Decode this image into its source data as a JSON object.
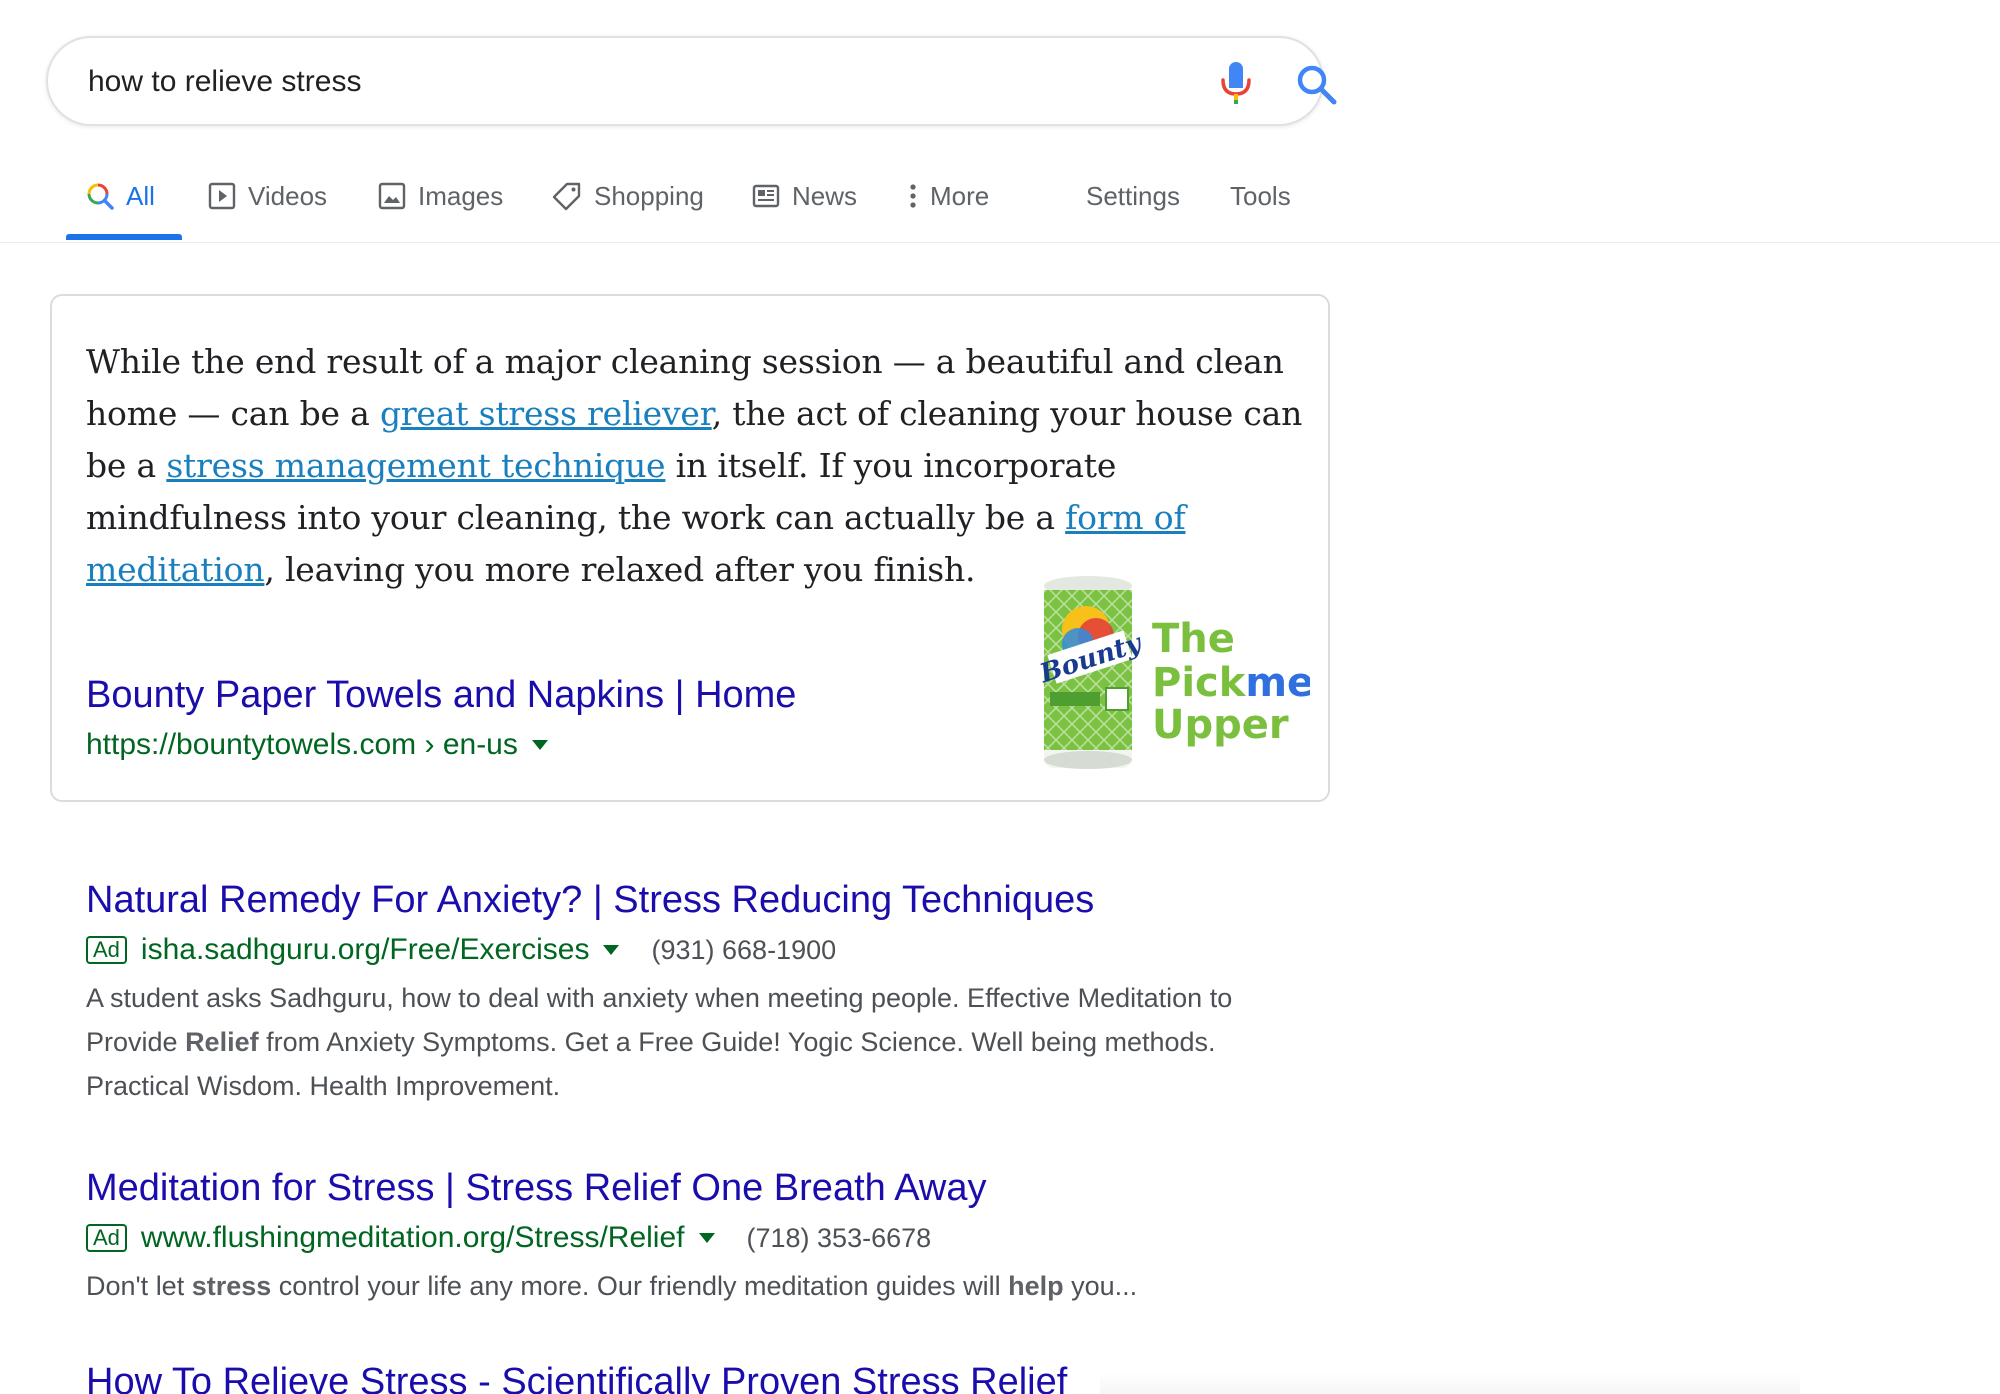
{
  "search": {
    "query": "how to relieve stress"
  },
  "tabs": [
    {
      "label": "All"
    },
    {
      "label": "Videos"
    },
    {
      "label": "Images"
    },
    {
      "label": "Shopping"
    },
    {
      "label": "News"
    },
    {
      "label": "More"
    },
    {
      "label": "Settings"
    },
    {
      "label": "Tools"
    }
  ],
  "featured": {
    "snippet_parts": [
      "While the end result of a major cleaning session — a beautiful and clean home — can be a ",
      "great stress reliever",
      ", the act of cleaning your house can be a ",
      "stress management technique",
      " in itself. If you incorporate mindfulness into your cleaning, the work can actually be a ",
      "form of meditation",
      ", leaving you more relaxed after you finish."
    ],
    "title": "Bounty Paper Towels and Napkins | Home",
    "url": "https://bountytowels.com › en-us",
    "image": {
      "brand": "Bounty",
      "line1": "The",
      "line2a": "Pick",
      "line2b": "me",
      "line3": "Upper"
    }
  },
  "results": [
    {
      "title": "Natural Remedy For Anxiety? | Stress Reducing Techniques",
      "ad_label": "Ad",
      "url": "isha.sadhguru.org/Free/Exercises",
      "phone": "(931) 668-1900",
      "desc_parts": [
        "A student asks Sadhguru, how to deal with anxiety when meeting people. Effective Meditation to Provide ",
        "Relief",
        " from Anxiety Symptoms. Get a Free Guide! Yogic Science. Well being methods. Practical Wisdom. Health Improvement."
      ]
    },
    {
      "title": "Meditation for Stress | Stress Relief One Breath Away",
      "ad_label": "Ad",
      "url": "www.flushingmeditation.org/Stress/Relief",
      "phone": "(718) 353-6678",
      "desc_parts": [
        "Don't let ",
        "stress",
        " control your life any more. Our friendly meditation guides will ",
        "help",
        " you..."
      ]
    },
    {
      "title": "How To Relieve Stress - Scientifically Proven Stress Relief"
    }
  ],
  "colors": {
    "link": "#1a0dab",
    "url_green": "#006621",
    "accent_blue": "#1a73e8",
    "snippet_link": "#1a7fbf"
  }
}
